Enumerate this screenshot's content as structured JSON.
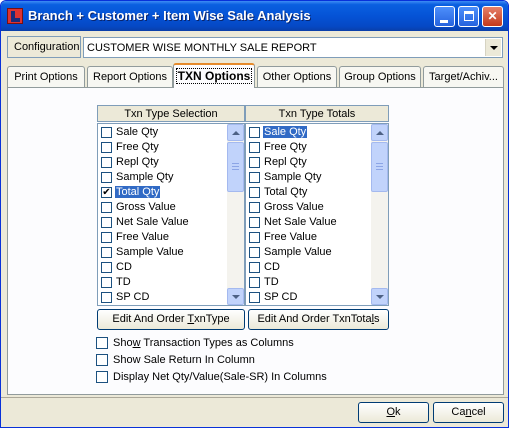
{
  "window": {
    "title": "Branch + Customer + Item Wise Sale Analysis",
    "controls": {
      "minimize": "minimize",
      "maximize": "maximize",
      "close": "close"
    }
  },
  "configuration": {
    "label": "Configuration",
    "value": "CUSTOMER WISE MONTHLY SALE REPORT"
  },
  "tabs": [
    {
      "label": "Print Options",
      "active": false
    },
    {
      "label": "Report Options",
      "active": false
    },
    {
      "label": "TXN Options",
      "active": true
    },
    {
      "label": "Other Options",
      "active": false
    },
    {
      "label": "Group Options",
      "active": false
    },
    {
      "label": "Target/Achiv...",
      "active": false
    }
  ],
  "txn_selection": {
    "header": "Txn Type Selection",
    "items": [
      {
        "label": "Sale Qty",
        "checked": false
      },
      {
        "label": "Free Qty",
        "checked": false
      },
      {
        "label": "Repl Qty",
        "checked": false
      },
      {
        "label": "Sample Qty",
        "checked": false
      },
      {
        "label": "Total Qty",
        "checked": true,
        "selected": true
      },
      {
        "label": "Gross Value",
        "checked": false
      },
      {
        "label": "Net Sale Value",
        "checked": false
      },
      {
        "label": "Free Value",
        "checked": false
      },
      {
        "label": "Sample Value",
        "checked": false
      },
      {
        "label": "CD",
        "checked": false
      },
      {
        "label": "TD",
        "checked": false
      },
      {
        "label": "SP CD",
        "checked": false
      }
    ],
    "button_prefix": "Edit And Order ",
    "button_hotkey": "T",
    "button_suffix": "xnType"
  },
  "txn_totals": {
    "header": "Txn Type Totals",
    "items": [
      {
        "label": "Sale Qty",
        "checked": false,
        "selected": true
      },
      {
        "label": "Free Qty",
        "checked": false
      },
      {
        "label": "Repl Qty",
        "checked": false
      },
      {
        "label": "Sample Qty",
        "checked": false
      },
      {
        "label": "Total Qty",
        "checked": false
      },
      {
        "label": "Gross Value",
        "checked": false
      },
      {
        "label": "Net Sale Value",
        "checked": false
      },
      {
        "label": "Free Value",
        "checked": false
      },
      {
        "label": "Sample Value",
        "checked": false
      },
      {
        "label": "CD",
        "checked": false
      },
      {
        "label": "TD",
        "checked": false
      },
      {
        "label": "SP CD",
        "checked": false
      }
    ],
    "button_prefix": "Edit And Order TxnTota",
    "button_hotkey": "l",
    "button_suffix": "s"
  },
  "options": [
    {
      "pre": "Sho",
      "hot": "w",
      "post": " Transaction Types as Columns",
      "checked": false
    },
    {
      "pre": "Show Sale Return In Column",
      "hot": "",
      "post": "",
      "checked": false
    },
    {
      "pre": "Display Net Qty/Value(Sale-SR) In Columns",
      "hot": "",
      "post": "",
      "checked": false
    }
  ],
  "footer": {
    "ok": {
      "hot": "O",
      "rest": "k"
    },
    "cancel": {
      "pre": "Ca",
      "hot": "n",
      "post": "cel"
    }
  },
  "colors": {
    "titlebar": "#0553d6",
    "selection": "#316ac5",
    "active_tab_accent": "#e68b2c",
    "face": "#ece9d8"
  }
}
